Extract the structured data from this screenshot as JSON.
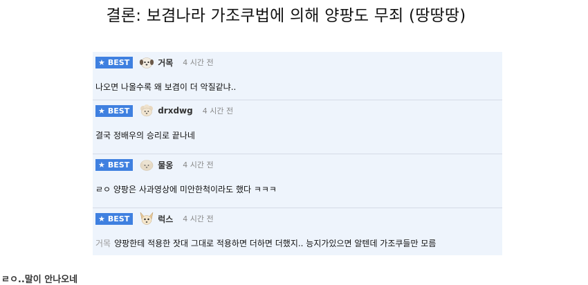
{
  "page": {
    "title": "결론: 보겸나라 가조쿠법에 의해 양팡도 무죄 (땅땅땅)"
  },
  "comments": [
    {
      "badge": "BEST",
      "nickname": "거목",
      "time": "4 시간 전",
      "text": "나오면 나올수록 왜 보겸이 더 악질같냐..",
      "avatar_icon": "white-dog-icon"
    },
    {
      "badge": "BEST",
      "nickname": "drxdwg",
      "time": "4 시간 전",
      "text": "결국 정배우의 승리로 끝나네",
      "avatar_icon": "poodle-icon"
    },
    {
      "badge": "BEST",
      "nickname": "물옹",
      "time": "4 시간 전",
      "text": "ㄹㅇ 양팡은 사과영상에 미안한척이라도 했다 ㅋㅋㅋ",
      "avatar_icon": "fluffy-dog-icon"
    },
    {
      "badge": "BEST",
      "nickname": "럭스",
      "time": "4 시간 전",
      "reply_to": "거목",
      "text": "양팡한테 적용한 잣대 그대로 적용하면 더하면 더했지.. 능지가있으면 알텐데 가조쿠들만 모름",
      "avatar_icon": "chihuahua-icon"
    }
  ],
  "footer": {
    "text": "ㄹㅇ..말이 안나오네"
  },
  "colors": {
    "badge": "#3f80e0",
    "panel": "#eef4fc"
  }
}
